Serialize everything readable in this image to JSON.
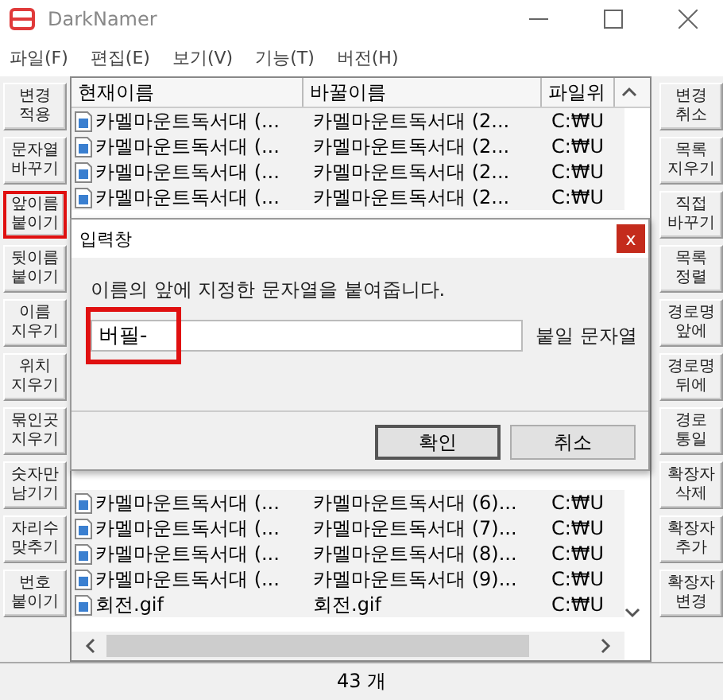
{
  "window": {
    "title": "DarkNamer"
  },
  "menu": [
    "파일(F)",
    "편집(E)",
    "보기(V)",
    "기능(T)",
    "버전(H)"
  ],
  "left_buttons": [
    {
      "label": "변경\n적용",
      "highlighted": false
    },
    {
      "label": "문자열\n바꾸기",
      "highlighted": false
    },
    {
      "label": "앞이름\n붙이기",
      "highlighted": true
    },
    {
      "label": "뒷이름\n붙이기",
      "highlighted": false
    },
    {
      "label": "이름\n지우기",
      "highlighted": false
    },
    {
      "label": "위치\n지우기",
      "highlighted": false
    },
    {
      "label": "묶인곳\n지우기",
      "highlighted": false
    },
    {
      "label": "숫자만\n남기기",
      "highlighted": false
    },
    {
      "label": "자리수\n맞추기",
      "highlighted": false
    },
    {
      "label": "번호\n붙이기",
      "highlighted": false
    }
  ],
  "table": {
    "columns": [
      "현재이름",
      "바꿀이름",
      "파일위"
    ],
    "rows_top": [
      [
        "카멜마운트독서대 (...",
        "카멜마운트독서대 (2...",
        "C:₩U"
      ],
      [
        "카멜마운트독서대 (...",
        "카멜마운트독서대 (2...",
        "C:₩U"
      ],
      [
        "카멜마운트독서대 (...",
        "카멜마운트독서대 (2...",
        "C:₩U"
      ],
      [
        "카멜마운트독서대 (...",
        "카멜마운트독서대 (2...",
        "C:₩U"
      ]
    ],
    "rows_bottom": [
      [
        "카멜마운트독서대 (...",
        "카멜마운트독서대 (6)...",
        "C:₩U"
      ],
      [
        "카멜마운트독서대 (...",
        "카멜마운트독서대 (7)...",
        "C:₩U"
      ],
      [
        "카멜마운트독서대 (...",
        "카멜마운트독서대 (8)...",
        "C:₩U"
      ],
      [
        "카멜마운트독서대 (...",
        "카멜마운트독서대 (9)...",
        "C:₩U"
      ],
      [
        "회전.gif",
        "회전.gif",
        "C:₩U"
      ]
    ]
  },
  "right_buttons": [
    "변경\n취소",
    "목록\n지우기",
    "직접\n바꾸기",
    "목록\n정렬",
    "경로명\n앞에",
    "경로명\n뒤에",
    "경로\n통일",
    "확장자\n삭제",
    "확장자\n추가",
    "확장자\n변경"
  ],
  "dialog": {
    "title": "입력창",
    "close": "x",
    "message": "이름의 앞에 지정한 문자열을 붙여줍니다.",
    "input": {
      "value": "버필-",
      "highlighted": true
    },
    "input_label": "붙일 문자열",
    "buttons": [
      "확인",
      "취소"
    ]
  },
  "status_bar": "43 개"
}
